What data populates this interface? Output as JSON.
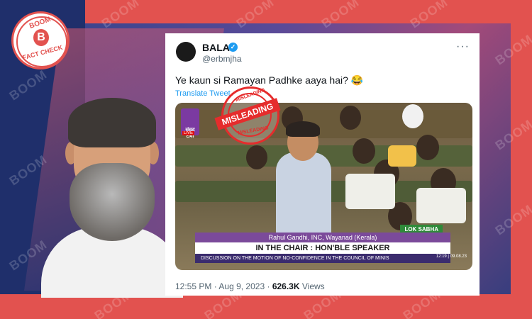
{
  "logo": {
    "brand_text": "BOOM",
    "brand_letter": "B",
    "tagline": "FACT CHECK"
  },
  "watermark_text": "BOOM",
  "tweet": {
    "user": {
      "name": "BALA",
      "handle": "@erbmjha",
      "verified": true
    },
    "text": "Ye kaun si Ramayan Padhke aaya hai? 😂",
    "translate_label": "Translate Tweet",
    "time": "12:55 PM",
    "date": "Aug 9, 2023",
    "views_count": "626.3K",
    "views_label": "Views"
  },
  "video": {
    "channel_logo_text": "संसद टीवी",
    "live_label": "LIVE",
    "lok_sabha_label": "LOK SABHA",
    "name_line": "Rahul Gandhi, INC, Wayanad (Kerala)",
    "chair_line": "IN THE CHAIR : HON'BLE SPEAKER",
    "ticker_line": "DISCUSSION ON THE MOTION OF NO-CONFIDENCE IN THE COUNCIL OF MINIS",
    "clock_text": "12:19 | 09.08.23"
  },
  "stamp": {
    "top_text": "MISLEADING",
    "band_text": "MISLEADING",
    "bottom_text": "MISLEADING"
  },
  "colors": {
    "accent_red": "#e2524f",
    "navy": "#1f2f6b",
    "twitter_blue": "#1d9bf0"
  }
}
